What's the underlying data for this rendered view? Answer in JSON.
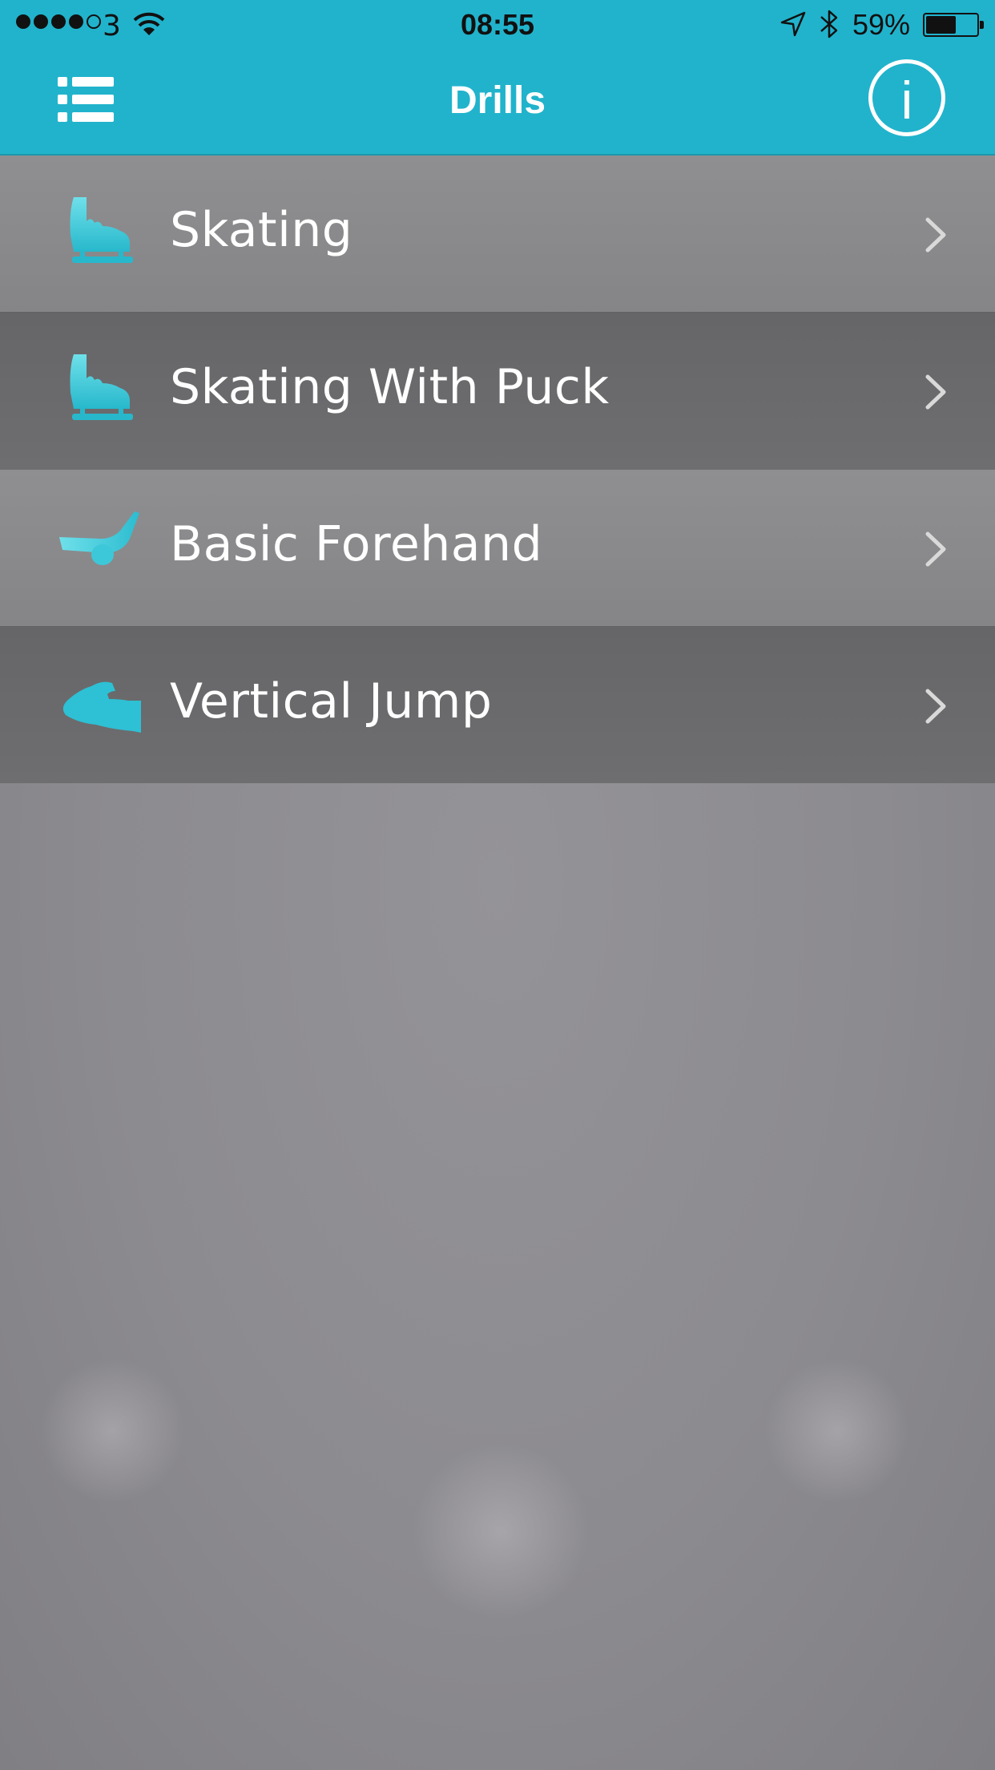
{
  "status_bar": {
    "carrier": "3",
    "time": "08:55",
    "battery_percent": "59%",
    "battery_level": 0.59,
    "signal_strength_of_5": 4
  },
  "header": {
    "title": "Drills",
    "menu_icon": "list-menu-icon",
    "info_icon": "info-icon",
    "info_glyph": "i"
  },
  "colors": {
    "accent": "#21b3cc",
    "icon_cyan": "#35c6d8",
    "row_light": "#8a8a8c",
    "row_dark": "#6a6a6c",
    "text": "#ffffff"
  },
  "drills": [
    {
      "label": "Skating",
      "icon": "ice-skate-icon"
    },
    {
      "label": "Skating With Puck",
      "icon": "ice-skate-icon"
    },
    {
      "label": "Basic Forehand",
      "icon": "hockey-stick-icon"
    },
    {
      "label": "Vertical Jump",
      "icon": "flexed-arm-icon"
    }
  ]
}
